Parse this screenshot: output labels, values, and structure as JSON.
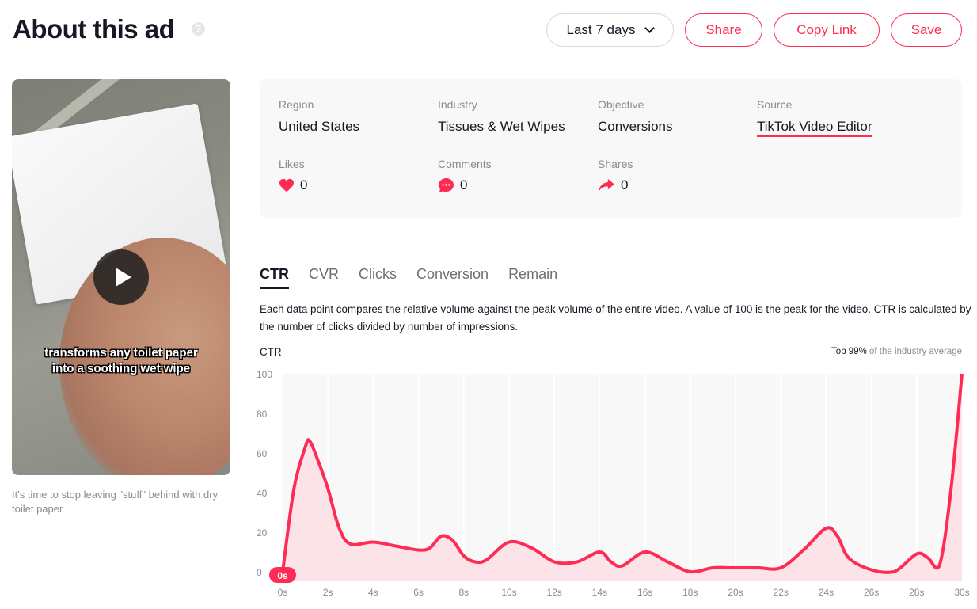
{
  "header": {
    "title": "About this ad",
    "help_icon": "question-circle-icon",
    "date_range": "Last 7 days",
    "buttons": {
      "share": "Share",
      "copy_link": "Copy Link",
      "save": "Save"
    }
  },
  "video": {
    "overlay_caption": [
      "transforms any toilet paper",
      "into a soothing wet wipe"
    ],
    "play_icon": "play-icon",
    "description": "It's time to stop leaving \"stuff\" behind with dry toilet paper"
  },
  "info": {
    "region": {
      "label": "Region",
      "value": "United States"
    },
    "industry": {
      "label": "Industry",
      "value": "Tissues & Wet Wipes"
    },
    "objective": {
      "label": "Objective",
      "value": "Conversions"
    },
    "source": {
      "label": "Source",
      "value": "TikTok Video Editor"
    },
    "likes": {
      "label": "Likes",
      "value": "0",
      "icon": "heart-icon"
    },
    "comments": {
      "label": "Comments",
      "value": "0",
      "icon": "comment-icon"
    },
    "shares": {
      "label": "Shares",
      "value": "0",
      "icon": "share-arrow-icon"
    }
  },
  "tabs": [
    {
      "label": "CTR",
      "active": true
    },
    {
      "label": "CVR",
      "active": false
    },
    {
      "label": "Clicks",
      "active": false
    },
    {
      "label": "Conversion",
      "active": false
    },
    {
      "label": "Remain",
      "active": false
    }
  ],
  "chart_section": {
    "description": "Each data point compares the relative volume against the peak volume of the entire video. A value of 100 is the peak for the video. CTR is calculated by the number of clicks divided by number of impressions.",
    "metric_label": "CTR",
    "rank_strong": "Top 99%",
    "rank_rest": " of the industry average"
  },
  "colors": {
    "accent": "#fe2c55",
    "fill": "#fbe3e8",
    "plot_bg": "#f8f8f8",
    "text": "#161823",
    "muted": "#8a8b91"
  },
  "chart_data": {
    "type": "area",
    "title": "CTR",
    "xlabel": "",
    "ylabel": "",
    "xlim": [
      0,
      30
    ],
    "ylim": [
      0,
      100
    ],
    "x_ticks": [
      "0s",
      "2s",
      "4s",
      "6s",
      "8s",
      "10s",
      "12s",
      "14s",
      "16s",
      "18s",
      "20s",
      "22s",
      "24s",
      "26s",
      "28s",
      "30s"
    ],
    "y_ticks": [
      0,
      20,
      40,
      60,
      80,
      100
    ],
    "grid": "vertical",
    "marker": {
      "x": 0,
      "label": "0s"
    },
    "series": [
      {
        "name": "CTR",
        "x": [
          0,
          0.5,
          1,
          1.2,
          1.6,
          2,
          2.5,
          3,
          4,
          5,
          6,
          6.5,
          7,
          7.5,
          8,
          8.5,
          9,
          10,
          11,
          12,
          13,
          14,
          14.5,
          15,
          16,
          17,
          18,
          19,
          20,
          21,
          22,
          23,
          24,
          24.5,
          25,
          26,
          27,
          28,
          28.5,
          29,
          29.5,
          30
        ],
        "values": [
          0,
          42,
          63,
          66,
          55,
          42,
          22,
          14,
          15,
          13,
          11,
          12,
          18,
          16,
          8,
          5,
          6,
          15,
          12,
          5,
          5,
          10,
          5,
          3,
          10,
          5,
          0,
          2,
          2,
          2,
          2,
          11,
          22,
          18,
          7,
          1,
          0,
          9,
          7,
          3,
          40,
          100
        ]
      }
    ]
  }
}
